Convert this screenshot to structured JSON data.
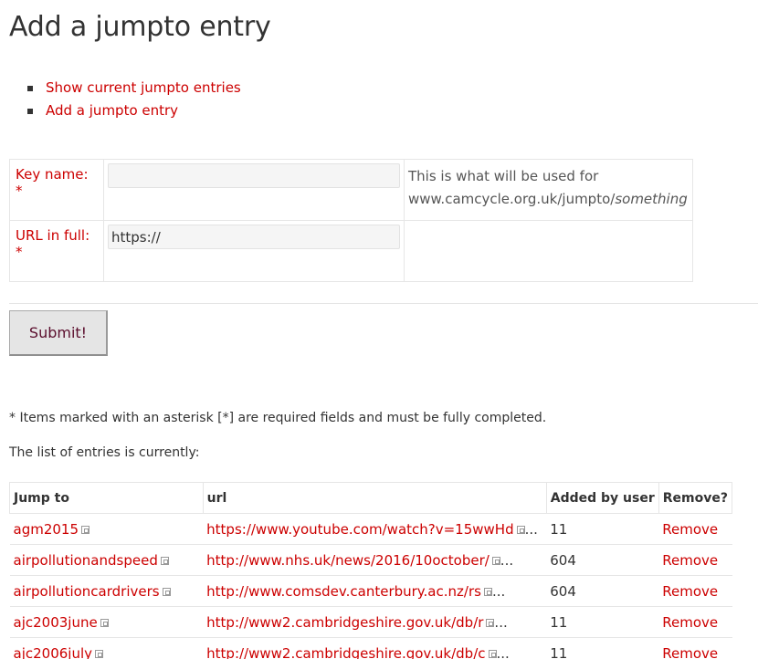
{
  "page": {
    "title": "Add a jumpto entry"
  },
  "nav": {
    "items": [
      {
        "label": "Show current jumpto entries"
      },
      {
        "label": "Add a jumpto entry"
      }
    ]
  },
  "form": {
    "key_label": "Key name: *",
    "key_value": "",
    "key_help_line1": "This is what will be used for",
    "key_help_prefix": "www.camcycle.org.uk/jumpto/",
    "key_help_italic": "something",
    "url_label": "URL in full: *",
    "url_value": "https://",
    "submit_label": "Submit!"
  },
  "notes": {
    "required": "* Items marked with an asterisk [*] are required fields and must be fully completed.",
    "list_intro": "The list of entries is currently:"
  },
  "entries": {
    "columns": [
      "Jump to",
      "url",
      "Added by user",
      "Remove?"
    ],
    "rows": [
      {
        "jump": "agm2015",
        "url": "https://www.youtube.com/watch?v=15wwHd",
        "user": "11",
        "remove": "Remove"
      },
      {
        "jump": "airpollutionandspeed",
        "url": "http://www.nhs.uk/news/2016/10october/",
        "user": "604",
        "remove": "Remove"
      },
      {
        "jump": "airpollutioncardrivers",
        "url": "http://www.comsdev.canterbury.ac.nz/rs",
        "user": "604",
        "remove": "Remove"
      },
      {
        "jump": "ajc2003june",
        "url": "http://www2.cambridgeshire.gov.uk/db/r",
        "user": "11",
        "remove": "Remove"
      },
      {
        "jump": "ajc2006july",
        "url": "http://www2.cambridgeshire.gov.uk/db/c",
        "user": "11",
        "remove": "Remove"
      }
    ],
    "ellipsis": "..."
  },
  "colors": {
    "link": "#cc0000",
    "text": "#333333",
    "submit_text": "#5b0e2d"
  }
}
